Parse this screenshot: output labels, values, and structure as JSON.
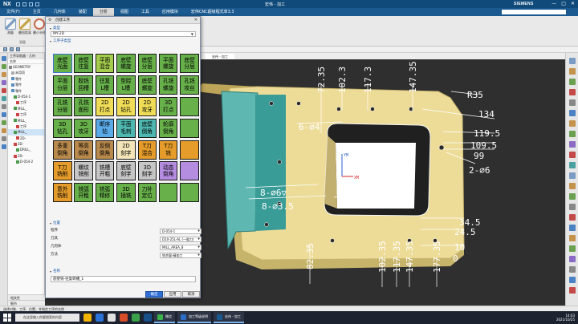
{
  "titlebar": {
    "logo": "NX",
    "title": "宏伟 - 加工",
    "brand": "SIEMENS",
    "controls": [
      "—",
      "□",
      "✕"
    ]
  },
  "menubar": {
    "items": [
      "文件(F)",
      "主页",
      "几何体",
      "装配",
      "分析",
      "视图",
      "工具",
      "应用模块",
      "宏伟CNC超级程式单3.3"
    ],
    "active_index": 4
  },
  "ribbon": {
    "buttons": [
      {
        "label": "测量",
        "icon": "ruler-icon",
        "color": "#7a9cc4"
      },
      {
        "label": "最短距离",
        "icon": "distance-icon",
        "color": "#c4a24a"
      },
      {
        "label": "最小半径",
        "icon": "radius-icon",
        "color": "#c66a4a"
      }
    ],
    "group_label": "测量"
  },
  "navigator": {
    "header": "工序导航器 - 几何",
    "column": "名称",
    "rows": [
      {
        "text": "GEOMETRY",
        "selected": false,
        "icon_color": "#888"
      },
      {
        "text": "未用项",
        "selected": false,
        "icon_color": "#aaa"
      },
      {
        "text": "零件",
        "selected": false,
        "icon_color": "#5a8fc4"
      },
      {
        "text": "零件",
        "selected": false,
        "icon_color": "#5a8fc4"
      },
      {
        "text": "零件",
        "selected": false,
        "icon_color": "#5a8fc4"
      },
      {
        "text": "D-054-1",
        "selected": false,
        "icon_color": "#4a9a4a"
      },
      {
        "text": "工序",
        "selected": false,
        "icon_color": "#c44"
      },
      {
        "text": "MILL_",
        "selected": false,
        "icon_color": "#4a9a4a"
      },
      {
        "text": "工序",
        "selected": false,
        "icon_color": "#c44"
      },
      {
        "text": "MILL_",
        "selected": false,
        "icon_color": "#4a9a4a"
      },
      {
        "text": "工序",
        "selected": false,
        "icon_color": "#c44"
      },
      {
        "text": "MILL_",
        "selected": true,
        "icon_color": "#4a9a4a"
      },
      {
        "text": "2D-",
        "selected": false,
        "icon_color": "#c44"
      },
      {
        "text": "2D-",
        "selected": false,
        "icon_color": "#c44"
      },
      {
        "text": "DRILL_",
        "selected": false,
        "icon_color": "#4a9a4a"
      },
      {
        "text": "2D-",
        "selected": false,
        "icon_color": "#c44"
      },
      {
        "text": "D-054-2",
        "selected": false,
        "icon_color": "#4a9a4a"
      }
    ],
    "footer_items": [
      "相关性",
      "细节"
    ]
  },
  "graphics": {
    "tab": "宏伟 - 加工"
  },
  "status_text": "选择对象、工序、位置，并指定工序的名称",
  "taskbar": {
    "search_placeholder": "在这里输入你要搜索的内容",
    "apps": [
      {
        "label": "微信",
        "color": "#3bb24a"
      },
      {
        "label": "加工等级说明",
        "color": "#2b6cc4"
      },
      {
        "label": "宏伟 - 加工",
        "color": "#1a5a90"
      }
    ],
    "time": "14:03",
    "date": "2021/10/25"
  },
  "dialog": {
    "title": "创建工序",
    "sections": {
      "type": "类型",
      "subtype": "工序子类型",
      "location": "位置",
      "name": "名称"
    },
    "type_value": "MY-2D",
    "subtypes": [
      {
        "text": "底壁\n光面",
        "color": "c-green"
      },
      {
        "text": "底壁\n往复",
        "color": "c-green"
      },
      {
        "text": "平面\n混合",
        "color": "c-lime"
      },
      {
        "text": "底壁\n螺旋",
        "color": "c-green"
      },
      {
        "text": "底壁\n分层",
        "color": "c-green"
      },
      {
        "text": "平面\n螺旋",
        "color": "c-green"
      },
      {
        "text": "底壁\n分层",
        "color": "c-green"
      },
      {
        "text": "平面\n分层",
        "color": "c-green"
      },
      {
        "text": "胶铣\n回槽",
        "color": "c-green"
      },
      {
        "text": "往复\nL槽",
        "color": "c-green"
      },
      {
        "text": "型腔\nL槽",
        "color": "c-green"
      },
      {
        "text": "底壁\n螺旋",
        "color": "c-green"
      },
      {
        "text": "孔铣\n螺旋",
        "color": "c-green"
      },
      {
        "text": "孔铣\n攻丝",
        "color": "c-green"
      },
      {
        "text": "孔铣\n分层",
        "color": "c-green"
      },
      {
        "text": "孔铣\n面形",
        "color": "c-green"
      },
      {
        "text": "2D\n打点",
        "color": "c-yellow"
      },
      {
        "text": "2D\n钻孔",
        "color": "c-yellow"
      },
      {
        "text": "2D\n攻牙",
        "color": "c-yellow"
      },
      {
        "text": "3D\n打点",
        "color": "c-green"
      },
      {
        "text": "",
        "color": "c-green"
      },
      {
        "text": "3D\n钻孔",
        "color": "c-green"
      },
      {
        "text": "3D\n攻牙",
        "color": "c-green"
      },
      {
        "text": "断序\n钻",
        "color": "c-blue"
      },
      {
        "text": "平面\n毛刺",
        "color": "c-teal"
      },
      {
        "text": "底壁\n倒角",
        "color": "c-teal"
      },
      {
        "text": "轮廓\n倒角",
        "color": "c-green"
      },
      {
        "text": "",
        "color": "c-green"
      },
      {
        "text": "多重\n倒角",
        "color": "c-brown"
      },
      {
        "text": "等高\n倒角",
        "color": "c-brown"
      },
      {
        "text": "反侧\n倒角",
        "color": "c-brown"
      },
      {
        "text": "2D\n刻字",
        "color": "c-cream"
      },
      {
        "text": "T刀\n混合",
        "color": "c-orange"
      },
      {
        "text": "T刀\n铣",
        "color": "c-orange"
      },
      {
        "text": "",
        "color": "c-orange"
      },
      {
        "text": "T刀\n铣削",
        "color": "c-orange"
      },
      {
        "text": "螺纹\n铣削",
        "color": "c-grey"
      },
      {
        "text": "铣槽\n开粗",
        "color": "c-grey"
      },
      {
        "text": "底壁\n刻字",
        "color": "c-grey"
      },
      {
        "text": "3D\n刻字",
        "color": "c-grey"
      },
      {
        "text": "动态\n倒角",
        "color": "c-purple"
      },
      {
        "text": "",
        "color": "c-purple"
      },
      {
        "text": "意外\n铣削",
        "color": "c-orange"
      },
      {
        "text": "铣弧\n开粗",
        "color": "c-green"
      },
      {
        "text": "铣弧\n精修",
        "color": "c-green"
      },
      {
        "text": "3D\n插铣",
        "color": "c-green"
      },
      {
        "text": "刀补\n定位",
        "color": "c-green"
      },
      {
        "text": "",
        "color": "c-green"
      },
      {
        "text": "",
        "color": "c-green"
      }
    ],
    "location": [
      {
        "label": "程序",
        "value": "D-054-1"
      },
      {
        "label": "刀具",
        "value": "D10-25L-AL (一般刀)"
      },
      {
        "label": "几何体",
        "value": "MILL_AREA_8"
      },
      {
        "label": "方法",
        "value": "铣余量-精加工"
      }
    ],
    "name_value": "底壁铣-往复转槽_1",
    "buttons": {
      "ok": "确定",
      "apply": "应用",
      "cancel": "取消"
    }
  },
  "drawing": {
    "labels": {
      "r35": "R35",
      "d134": "134",
      "d1195": "119.5",
      "d1095": "109.5",
      "d99": "99",
      "phi6_2": "2-∅6",
      "phi6_6": "6-∅4",
      "r15": "4-R15",
      "phi6_8": "8-∅6▽",
      "phi3": "8-∅3.5",
      "d345": "34.5",
      "d245": "24.5",
      "d10": "10",
      "d0": "0",
      "t723": "72.35",
      "t10275": "102.3",
      "t1173": "117.3",
      "t1473": "147.35",
      "b8235": "82.35",
      "b1023": "102.35",
      "b1173": "117.35",
      "b147": "147.35",
      "b177": "177.35",
      "bm1": "142",
      "xm": "XM",
      "ym": "YM"
    }
  }
}
